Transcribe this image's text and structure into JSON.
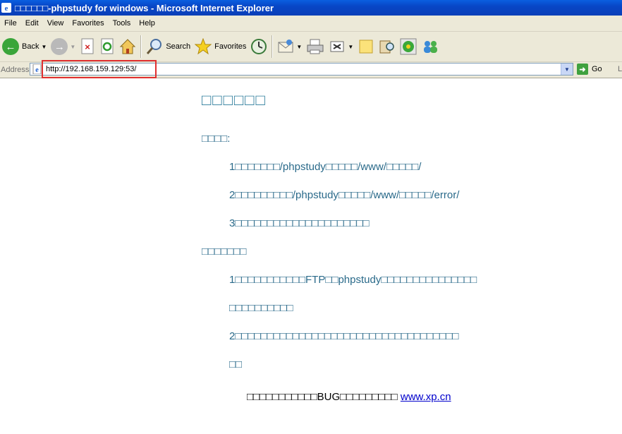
{
  "window": {
    "title": "□□□□□□-phpstudy for windows - Microsoft Internet Explorer"
  },
  "menu": [
    "File",
    "Edit",
    "View",
    "Favorites",
    "Tools",
    "Help"
  ],
  "toolbar": {
    "back_label": "Back",
    "search_label": "Search",
    "favorites_label": "Favorites"
  },
  "address": {
    "label": "Address",
    "url": "http://192.168.159.129:53/",
    "go_label": "Go",
    "links_label": "L"
  },
  "page": {
    "heading": "□□□□□□",
    "section1_title": "□□□□:",
    "section1_items": [
      "1□□□□□□□/phpstudy□□□□□/www/□□□□□/",
      "2□□□□□□□□□/phpstudy□□□□□/www/□□□□□/error/",
      "3□□□□□□□□□□□□□□□□□□□□□"
    ],
    "section2_title": "□□□□□□□",
    "section2_item1_line1": "1□□□□□□□□□□□FTP□□phpstudy□□□□□□□□□□□□□□□",
    "section2_item1_line2": "□□□□□□□□□□",
    "section2_item2_line1": "2□□□□□□□□□□□□□□□□□□□□□□□□□□□□□□□□□□□",
    "section2_item2_line2": "□□",
    "footer_text": "□□□□□□□□□□□BUG□□□□□□□□□ ",
    "footer_link": "www.xp.cn"
  }
}
